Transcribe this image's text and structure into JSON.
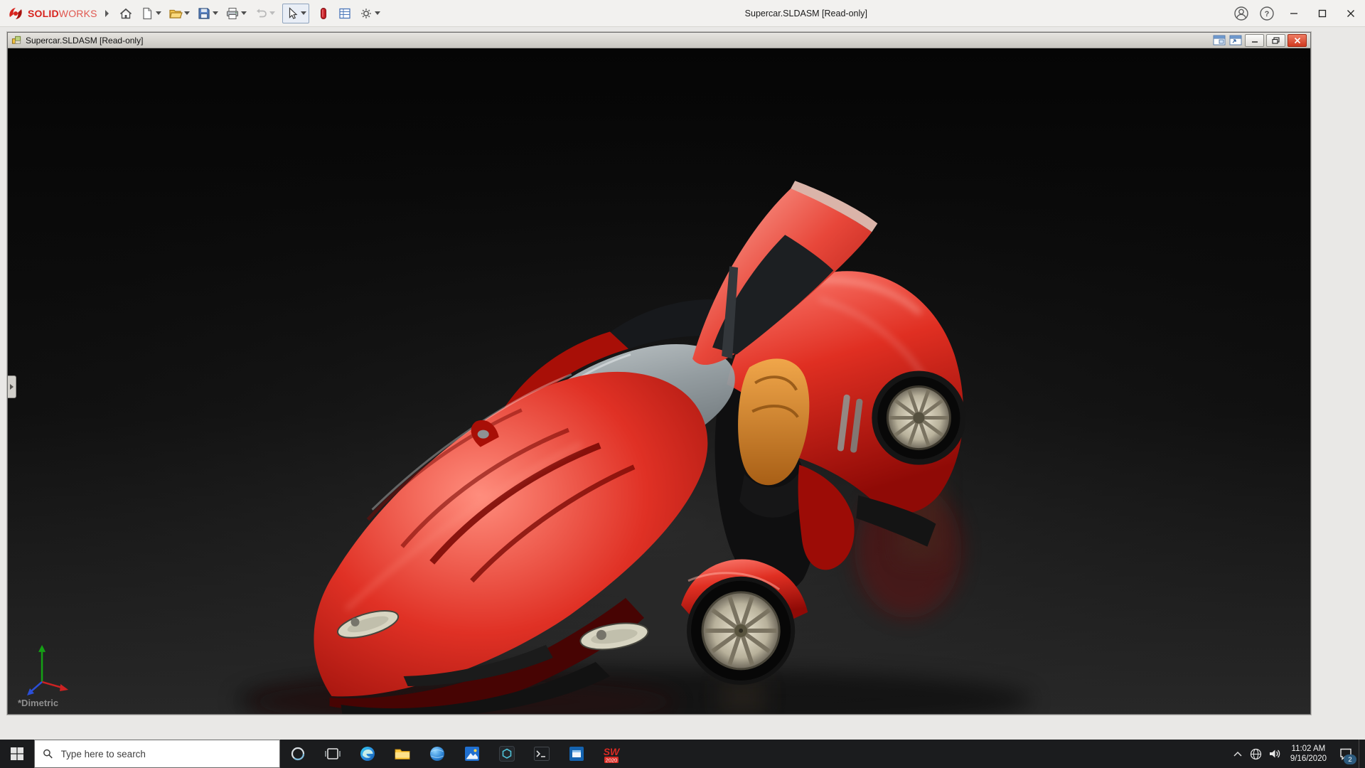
{
  "app": {
    "brand_bold": "SOLID",
    "brand_light": "WORKS",
    "title": "Supercar.SLDASM [Read-only]",
    "help_glyph": "?"
  },
  "toolbar": {
    "buttons": [
      "home",
      "new-document",
      "open",
      "save",
      "print",
      "undo",
      "select",
      "red-marker",
      "evaluate-grid",
      "options"
    ]
  },
  "doc": {
    "title": "Supercar.SLDASM [Read-only]",
    "view_label": "*Dimetric"
  },
  "taskbar": {
    "search_placeholder": "Type here to search",
    "sw_logo": "SW",
    "sw_year": "2020",
    "icons": [
      "start",
      "cortana",
      "task-view",
      "edge",
      "file-explorer",
      "browser-globe",
      "photos",
      "hexagon-app",
      "terminal",
      "blue-window-app",
      "solidworks-2020"
    ]
  },
  "tray": {
    "icons": [
      "hidden-icons-chevron",
      "network",
      "volume",
      "clock",
      "notification-center"
    ],
    "time": "11:02 AM",
    "date": "9/16/2020",
    "notification_count": "2"
  },
  "colors": {
    "solidworks_red": "#d7231d",
    "doc_close_red": "#d03a20",
    "car_body_red": "#d01810",
    "seat_orange": "#d98a2b",
    "taskbar_bg": "#1b1c1e",
    "titlebar_bg": "#f2f1ef",
    "viewport_bg": "#0a0a0a"
  }
}
